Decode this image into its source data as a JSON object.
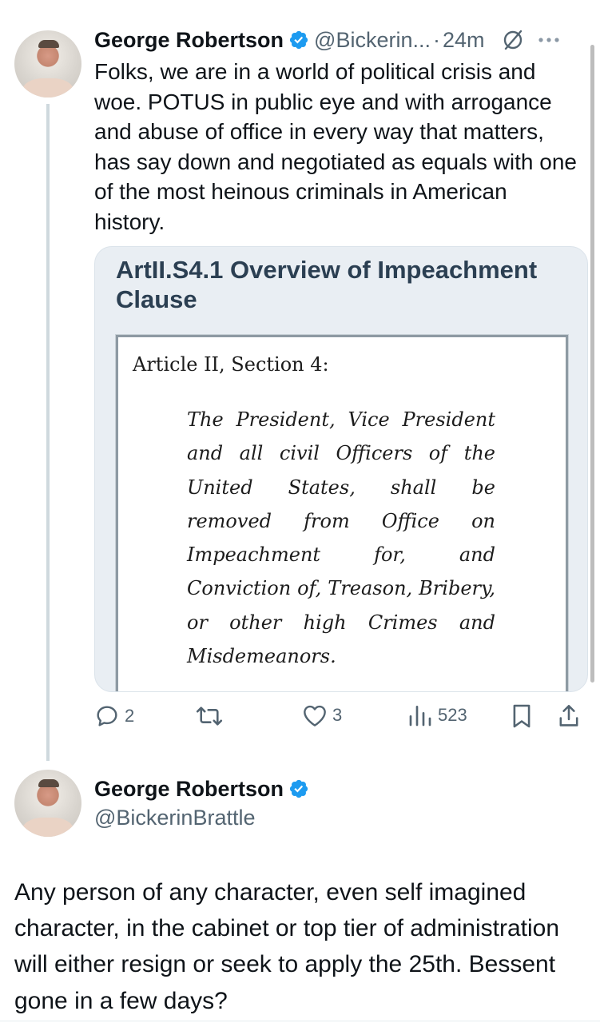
{
  "tweet": {
    "author_name": "George Robertson",
    "author_handle": "@Bickerin...",
    "separator": "·",
    "time": "24m",
    "text": "Folks, we are in a world of political crisis and woe. POTUS in public eye and with arrogance and abuse of office in every way that matters, has say down and negotiated as equals with one of the most heinous criminals in American history.",
    "card": {
      "title": "ArtII.S4.1 Overview of Impeachment Clause",
      "doc_heading": "Article II, Section 4:",
      "doc_body": "The President, Vice President and all civil Officers of the United States, shall be removed from Office on Impeachment for, and Conviction of, Treason, Bribery, or other high Crimes and Misdemeanors."
    },
    "actions": {
      "replies": "2",
      "reposts": "",
      "likes": "3",
      "views": "523"
    }
  },
  "reply": {
    "author_name": "George Robertson",
    "author_handle": "@BickerinBrattle",
    "text": "Any person of any character,  even self imagined character, in the cabinet or top tier of administration will either  resign or seek to apply the 25th.   Bessent gone in a few days?"
  },
  "icons": {
    "verified": "verified-badge-icon",
    "grok": "grok-icon",
    "more": "more-icon",
    "reply": "reply-icon",
    "repost": "repost-icon",
    "like": "like-icon",
    "views": "views-icon",
    "bookmark": "bookmark-icon",
    "share": "share-icon"
  },
  "colors": {
    "verified_blue": "#1d9bf0",
    "secondary_text": "#536471",
    "card_bg": "#e9eef3",
    "card_title": "#2b3f52"
  }
}
